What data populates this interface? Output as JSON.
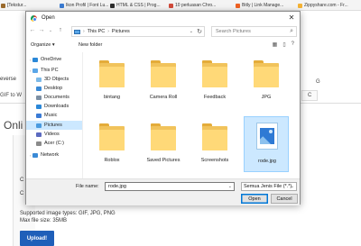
{
  "bookmarks": [
    {
      "label": "[Tekstur...",
      "color": "#9a6a2c"
    },
    {
      "label": "Ikon Profil | Font Lu...",
      "color": "#3b7bd1"
    },
    {
      "label": "HTML & CSS | Prog...",
      "color": "#2d2d2d"
    },
    {
      "label": "10 perluasan Chro...",
      "color": "#d14b3b"
    },
    {
      "label": "Bitly | Link Manage...",
      "color": "#ee6123"
    },
    {
      "label": "Zippyshare.com - Fr...",
      "color": "#f5b335"
    }
  ],
  "background": {
    "nav_text": "everse",
    "tab_left": "GIF to W",
    "tab_right": "C",
    "tab_right_g": "G",
    "heading": "Onli",
    "letters": [
      "C",
      "C"
    ],
    "supported": "Supported image types: GIF, JPG, PNG",
    "max_size": "Max file size: 35MB",
    "upload_label": "Upload!"
  },
  "dialog": {
    "title": "Open",
    "close_glyph": "✕",
    "address": [
      "This PC",
      "Pictures"
    ],
    "search_placeholder": "Search Pictures",
    "toolbar": {
      "organize": "Organize ▾",
      "new_folder": "New folder"
    },
    "nav_items": [
      {
        "label": "OneDrive",
        "icon": "cloud-icon",
        "color": "#2b88d8",
        "selected": false,
        "level": 0
      },
      {
        "label": "This PC",
        "icon": "pc-icon",
        "color": "#5aa6e8",
        "selected": false,
        "level": 0
      },
      {
        "label": "3D Objects",
        "icon": "3d-objects-icon",
        "color": "#7cb9e8",
        "selected": false,
        "level": 1
      },
      {
        "label": "Desktop",
        "icon": "desktop-icon",
        "color": "#3a8ad6",
        "selected": false,
        "level": 1
      },
      {
        "label": "Documents",
        "icon": "documents-icon",
        "color": "#7d8fa3",
        "selected": false,
        "level": 1
      },
      {
        "label": "Downloads",
        "icon": "downloads-icon",
        "color": "#2b88d8",
        "selected": false,
        "level": 1
      },
      {
        "label": "Music",
        "icon": "music-icon",
        "color": "#3a7bd5",
        "selected": false,
        "level": 1
      },
      {
        "label": "Pictures",
        "icon": "pictures-icon",
        "color": "#4a9be0",
        "selected": true,
        "level": 1
      },
      {
        "label": "Videos",
        "icon": "videos-icon",
        "color": "#5c6bc0",
        "selected": false,
        "level": 1
      },
      {
        "label": "Acer (C:)",
        "icon": "drive-icon",
        "color": "#8a8a8a",
        "selected": false,
        "level": 1
      },
      {
        "label": "Network",
        "icon": "network-icon",
        "color": "#3a8ad6",
        "selected": false,
        "level": 0
      }
    ],
    "files": [
      {
        "label": "bintang",
        "kind": "folder",
        "selected": false
      },
      {
        "label": "Camera Roll",
        "kind": "folder",
        "selected": false
      },
      {
        "label": "Feedback",
        "kind": "folder",
        "selected": false
      },
      {
        "label": "JPG",
        "kind": "folder",
        "selected": false
      },
      {
        "label": "Roblox",
        "kind": "folder",
        "selected": false
      },
      {
        "label": "Saved Pictures",
        "kind": "folder",
        "selected": false
      },
      {
        "label": "Screenshots",
        "kind": "folder",
        "selected": false
      },
      {
        "label": "rode.jpg",
        "kind": "image",
        "selected": true
      }
    ],
    "file_name_label": "File name:",
    "file_name_value": "rode.jpg",
    "file_type_value": "Semua Jenis File (*.*)",
    "open_label": "Open",
    "cancel_label": "Cancel"
  },
  "colors": {
    "accent": "#0078d7",
    "selection": "#cce8ff",
    "upload": "#1f5fb9",
    "folder": "#ffd978"
  }
}
